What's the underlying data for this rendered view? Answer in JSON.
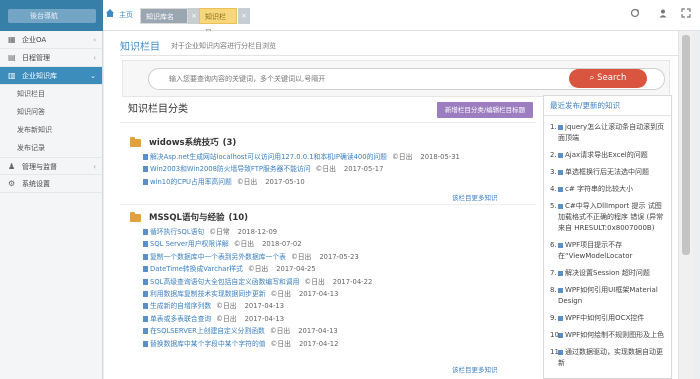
{
  "topbar": {
    "brand_label": "後台導航",
    "home_crumb": "主页",
    "tabs": [
      {
        "label": "知识库名"
      },
      {
        "label": "知识栏目"
      }
    ],
    "close_glyph": "×",
    "refresh_icon": "refresh-icon",
    "fullscreen_icon": "expand-icon"
  },
  "sidebar": {
    "items": [
      {
        "label": "企业OA",
        "icon": "grid-icon",
        "chevron": "‹"
      },
      {
        "label": "日程管理",
        "icon": "calendar-icon",
        "chevron": "‹"
      },
      {
        "label": "企业知识库",
        "icon": "book-icon",
        "chevron": "⌄",
        "active": true
      },
      {
        "label": "管理与监督",
        "icon": "users-icon",
        "chevron": "‹"
      },
      {
        "label": "系统设置",
        "icon": "gear-icon",
        "chevron": ""
      }
    ],
    "subitems": [
      {
        "label": "知识栏目"
      },
      {
        "label": "知识问答"
      },
      {
        "label": "发布新知识"
      },
      {
        "label": "发布记录"
      }
    ]
  },
  "main": {
    "title": "知识栏目",
    "desc": "对于企业知识内容进行分栏目浏览",
    "search": {
      "placeholder": "输入您要查询内容的关键词，多个关键词以,号隔开",
      "button": "Search"
    },
    "category_title": "知识栏目分类",
    "category_button": "新增栏目分类/编辑栏目标题",
    "more_link": "该栏目更多知识",
    "groups": [
      {
        "name": "widows系统技巧",
        "count": "(3)",
        "rows": [
          {
            "title": "解决Asp.net生成网站localhost可以访问用127.0.0.1和本机IP确读400的问题",
            "author": "©日出",
            "date": "2018-05-31"
          },
          {
            "title": "Win2003和Win2008防火墙导致FTP服务器不能访问",
            "author": "©日出",
            "date": "2017-05-17"
          },
          {
            "title": "win10的CPU占用率高问题",
            "author": "©日出",
            "date": "2017-05-10"
          }
        ]
      },
      {
        "name": "MSSQL语句与经验",
        "count": "(10)",
        "rows": [
          {
            "title": "循环执行SQL语句",
            "author": "©日常",
            "date": "2018-12-09"
          },
          {
            "title": "SQL Server用户权限详解",
            "author": "©日出",
            "date": "2018-07-02"
          },
          {
            "title": "复制一个数据库中一个表到另外数据库一个表",
            "author": "©日出",
            "date": "2017-05-23"
          },
          {
            "title": "DateTime转换成Varchar样式",
            "author": "©日出",
            "date": "2017-04-25"
          },
          {
            "title": "SQL高级查询语句大全包括自定义函数编写和调用",
            "author": "©日出",
            "date": "2017-04-22"
          },
          {
            "title": "利用数据库复制技术实现数据同步更新",
            "author": "©日出",
            "date": "2017-04-13"
          },
          {
            "title": "生成新的自增序列数",
            "author": "©日出",
            "date": "2017-04-13"
          },
          {
            "title": "单表或多表联合查询",
            "author": "©日出",
            "date": "2017-04-13"
          },
          {
            "title": "在SQLSERVER上创建自定义分割函数",
            "author": "©日出",
            "date": "2017-04-13"
          },
          {
            "title": "替换数据库中某个字段中某个字符的值",
            "author": "©日出",
            "date": "2017-04-12"
          }
        ]
      }
    ]
  },
  "recent": {
    "title": "最近发布/更新的知识",
    "items": [
      {
        "num": "1.",
        "text": "jquery怎么让滚动条自动滚到页面顶端"
      },
      {
        "num": "2.",
        "text": "Ajax请求导出Excel的问题"
      },
      {
        "num": "3.",
        "text": "单选框换行后无法选中问题"
      },
      {
        "num": "4.",
        "text": "c# 字符串的比较大小"
      },
      {
        "num": "5.",
        "text": "C#中导入DllImport 提示 试图加载格式不正确的程序 错误 (异常来自 HRESULT:0x8007000B)"
      },
      {
        "num": "6.",
        "text": "WPF项目提示不存在“ViewModelLocator"
      },
      {
        "num": "7.",
        "text": "解决设置Session 超时问题"
      },
      {
        "num": "8.",
        "text": "WPF如何引用UI框架Material Design"
      },
      {
        "num": "9.",
        "text": "WPF中如何引用OCX控件"
      },
      {
        "num": "10.",
        "text": "WPF如何绘制不规则图形及上色"
      },
      {
        "num": "11.",
        "text": "通过数据驱动，实现数据自动更新"
      }
    ]
  },
  "colors": {
    "brand": "#367fa9",
    "link": "#3a7fc1",
    "search_button": "#d9553f",
    "category_button": "#9c7dbf",
    "folder": "#e2a03f",
    "active_tab": "#f7d77b"
  }
}
